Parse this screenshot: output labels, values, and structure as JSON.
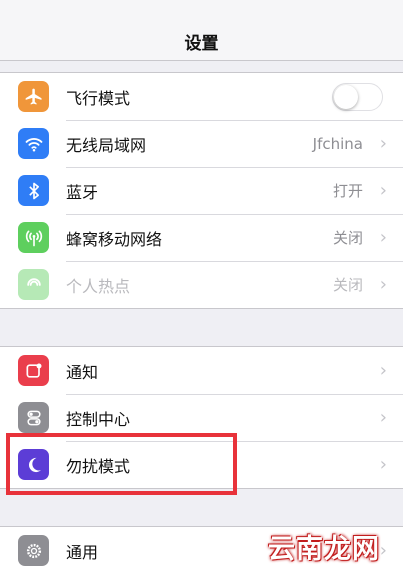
{
  "nav": {
    "title": "设置"
  },
  "group1": [
    {
      "label": "飞行模式",
      "icon": "airplane-icon",
      "color": "#f0963a",
      "control": "toggle",
      "toggle_on": false
    },
    {
      "label": "无线局域网",
      "icon": "wifi-icon",
      "color": "#2f7df6",
      "value": "Jfchina"
    },
    {
      "label": "蓝牙",
      "icon": "bluetooth-icon",
      "color": "#2f7df6",
      "value": "打开"
    },
    {
      "label": "蜂窝移动网络",
      "icon": "cellular-icon",
      "color": "#5ecf5e",
      "value": "关闭"
    },
    {
      "label": "个人热点",
      "icon": "hotspot-icon",
      "color": "#5ecf5e",
      "value": "关闭",
      "disabled": true
    }
  ],
  "group2": [
    {
      "label": "通知",
      "icon": "notification-icon",
      "color": "#ea3e4c"
    },
    {
      "label": "控制中心",
      "icon": "control-center-icon",
      "color": "#8e8e93"
    },
    {
      "label": "勿扰模式",
      "icon": "moon-icon",
      "color": "#5c3dd6"
    }
  ],
  "group3": [
    {
      "label": "通用",
      "icon": "gear-icon",
      "color": "#8e8e93"
    }
  ],
  "chevron": "›",
  "watermark": "云南龙网"
}
